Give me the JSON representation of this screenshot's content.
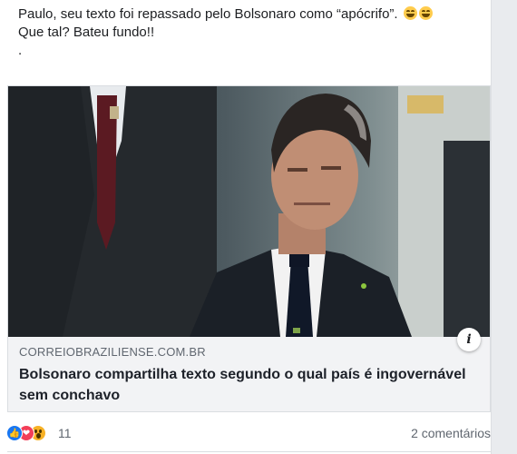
{
  "post": {
    "line1": "Paulo, seu texto foi repassado pelo Bolsonaro como “apócrifo”.",
    "line2": "Que tal? Bateu fundo!!",
    "line3": "."
  },
  "link_preview": {
    "domain": "CORREIOBRAZILIENSE.COM.BR",
    "headline": "Bolsonaro compartilha texto segundo o qual país é ingovernável sem conchavo",
    "info_icon": "i"
  },
  "reactions": {
    "icons": [
      "like-icon",
      "love-icon",
      "wow-icon"
    ],
    "count": "11"
  },
  "comments": "2 comentários",
  "colors": {
    "like": "#1877f2",
    "love": "#f33e58",
    "wow": "#f7b125",
    "muted_text": "#606770"
  }
}
